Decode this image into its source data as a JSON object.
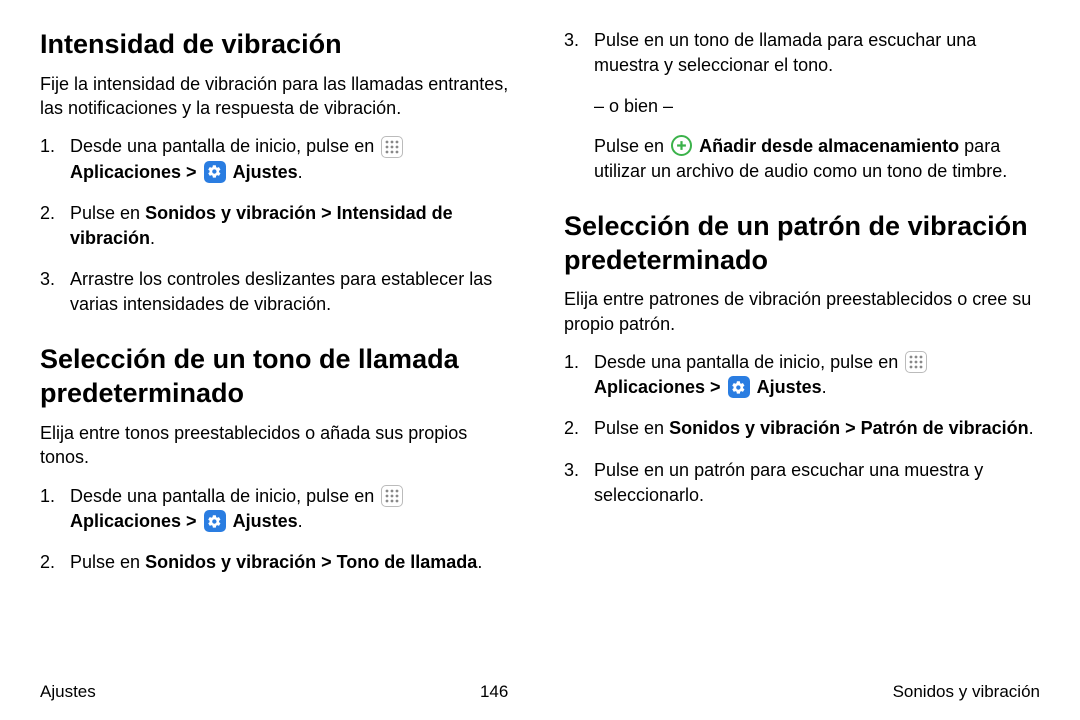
{
  "left": {
    "h1": "Intensidad de vibración",
    "p1": "Fije la intensidad de vibración para las llamadas entrantes, las notificaciones y la respuesta de vibración.",
    "s1": {
      "li1_pre": "Desde una pantalla de inicio, pulse en ",
      "apps": "Aplicaciones",
      "sep": " > ",
      "settings": "Ajustes",
      "period": ".",
      "li2_pre": "Pulse en ",
      "li2_bold": "Sonidos y vibración > Intensidad de vibración",
      "li3": "Arrastre los controles deslizantes para establecer las varias intensidades de vibración."
    },
    "h2": "Selección de un tono de llamada predeterminado",
    "p2": "Elija entre tonos preestablecidos o añada sus propios tonos.",
    "s2": {
      "li1_pre": "Desde una pantalla de inicio, pulse en ",
      "li2_pre": "Pulse en ",
      "li2_bold": "Sonidos y vibración > Tono de llamada"
    }
  },
  "right": {
    "li3": "Pulse en un tono de llamada para escuchar una muestra y seleccionar el tono.",
    "or": "– o bien –",
    "add_pre": "Pulse en ",
    "add_bold": "Añadir desde almacenamiento",
    "add_post": " para utilizar un archivo de audio como un tono de timbre.",
    "h1": "Selección de un patrón de vibración predeterminado",
    "p1": "Elija entre patrones de vibración preestablecidos o cree su propio patrón.",
    "s1": {
      "li1_pre": "Desde una pantalla de inicio, pulse en ",
      "li2_pre": "Pulse en ",
      "li2_bold": "Sonidos y vibración > Patrón de vibración",
      "li3": "Pulse en un patrón para escuchar una muestra y seleccionarlo."
    }
  },
  "icons": {
    "apps": "apps-grid-icon",
    "settings": "gear-icon",
    "plus": "plus-circle-icon"
  },
  "footer": {
    "left": "Ajustes",
    "center": "146",
    "right": "Sonidos y vibración"
  },
  "shared": {
    "apps": "Aplicaciones",
    "sep": " > ",
    "settings": "Ajustes",
    "period": "."
  }
}
